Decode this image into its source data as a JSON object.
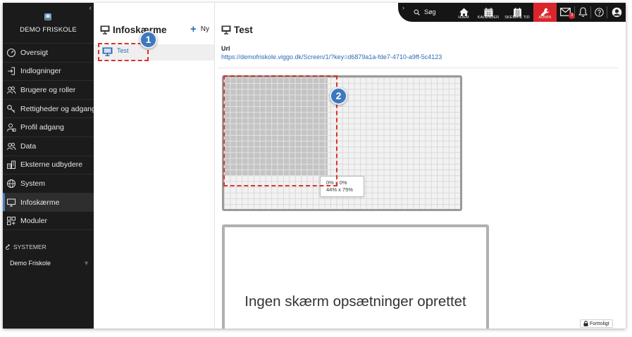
{
  "school": {
    "name": "DEMO FRISKOLE"
  },
  "sidebar": {
    "items": [
      {
        "label": "Oversigt",
        "icon": "dashboard-icon"
      },
      {
        "label": "Indlogninger",
        "icon": "login-icon"
      },
      {
        "label": "Brugere og roller",
        "icon": "users-icon"
      },
      {
        "label": "Rettigheder og adgang",
        "icon": "key-icon"
      },
      {
        "label": "Profil adgang",
        "icon": "profile-access-icon"
      },
      {
        "label": "Data",
        "icon": "data-icon"
      },
      {
        "label": "Eksterne udbydere",
        "icon": "external-providers-icon"
      },
      {
        "label": "System",
        "icon": "globe-icon"
      },
      {
        "label": "Infoskærme",
        "icon": "screen-icon",
        "active": true
      },
      {
        "label": "Moduler",
        "icon": "modules-icon"
      }
    ],
    "systems_label": "SYSTEMER",
    "system_selected": "Demo Friskole"
  },
  "list_panel": {
    "title": "Infoskærme",
    "new_label": "Ny",
    "items": [
      {
        "label": "Test"
      }
    ]
  },
  "topbar": {
    "search_label": "Søg",
    "buttons": [
      {
        "label": "HJEM",
        "icon": "home-icon"
      },
      {
        "label": "KALENDER",
        "icon": "calendar-icon"
      },
      {
        "label": "SKEMA & TID",
        "icon": "schedule-icon"
      },
      {
        "label": "ADMIN",
        "icon": "wrench-icon",
        "active": true
      }
    ],
    "message_badge": "3"
  },
  "main": {
    "title": "Test",
    "url_label": "Url",
    "url": "https://demofriskole.viggo.dk/Screen/1/?key=d6879a1a-fde7-4710-a9ff-5c4123",
    "selection": {
      "position": "0% x 0%",
      "size": "44% x 75%",
      "width_pct": 44,
      "height_pct": 75
    },
    "empty_message": "Ingen skærm opsætninger oprettet"
  },
  "footer": {
    "confidential_label": "Fortroligt"
  },
  "annotations": [
    {
      "number": "1"
    },
    {
      "number": "2"
    }
  ],
  "colors": {
    "accent": "#2b6cb0",
    "admin": "#d9252b",
    "annotation": "#d8332b",
    "sidebar": "#1b1b1b"
  }
}
